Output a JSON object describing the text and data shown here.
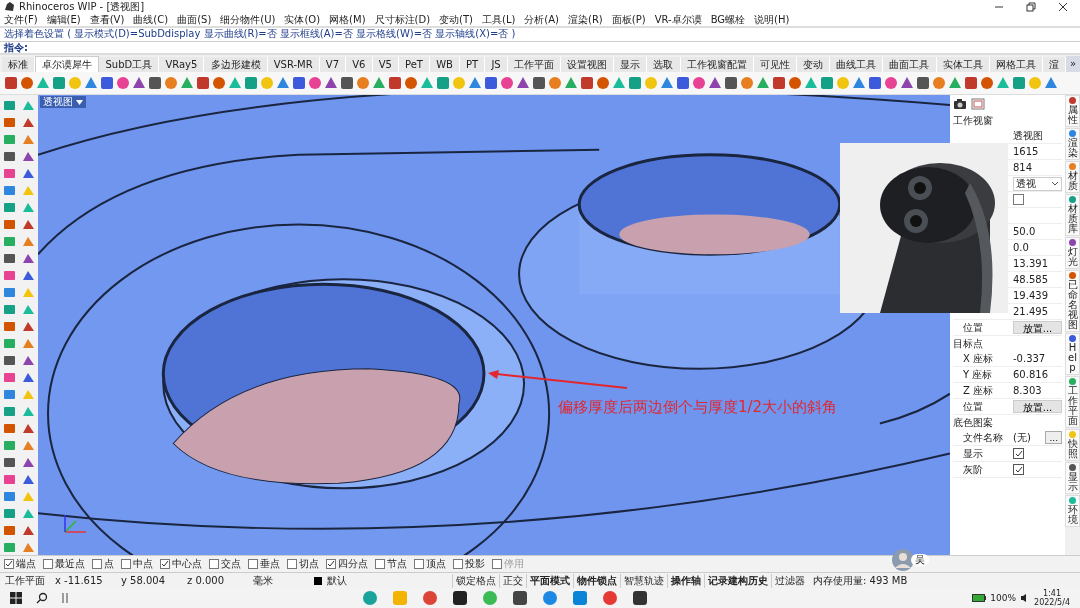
{
  "window": {
    "title": "Rhinoceros WIP - [透视图]"
  },
  "menu": [
    "文件(F)",
    "编辑(E)",
    "查看(V)",
    "曲线(C)",
    "曲面(S)",
    "细分物件(U)",
    "实体(O)",
    "网格(M)",
    "尺寸标注(D)",
    "变动(T)",
    "工具(L)",
    "分析(A)",
    "渲染(R)",
    "面板(P)",
    "VR-卓尔谟",
    "BG螺栓",
    "说明(H)"
  ],
  "command": {
    "history": "选择着色设置 ( 显示模式(D)=SubDdisplay  显示曲线(R)=否  显示框线(A)=否  显示格线(W)=否  显示轴线(X)=否 )",
    "prompt": "指令:"
  },
  "tabs": [
    {
      "label": "标准",
      "selected": false
    },
    {
      "label": "卓尔谟犀牛",
      "selected": true
    },
    {
      "label": "SubD工具",
      "selected": false
    },
    {
      "label": "VRay5",
      "selected": false
    },
    {
      "label": "多边形建模",
      "selected": false
    },
    {
      "label": "VSR-MR",
      "selected": false
    },
    {
      "label": "V7",
      "selected": false
    },
    {
      "label": "V6",
      "selected": false
    },
    {
      "label": "V5",
      "selected": false
    },
    {
      "label": "PeT",
      "selected": false
    },
    {
      "label": "WB",
      "selected": false
    },
    {
      "label": "PT",
      "selected": false
    },
    {
      "label": "JS",
      "selected": false
    },
    {
      "label": "工作平面",
      "selected": false
    },
    {
      "label": "设置视图",
      "selected": false
    },
    {
      "label": "显示",
      "selected": false
    },
    {
      "label": "选取",
      "selected": false
    },
    {
      "label": "工作视窗配置",
      "selected": false
    },
    {
      "label": "可见性",
      "selected": false
    },
    {
      "label": "变动",
      "selected": false
    },
    {
      "label": "曲线工具",
      "selected": false
    },
    {
      "label": "曲面工具",
      "selected": false
    },
    {
      "label": "实体工具",
      "selected": false
    },
    {
      "label": "网格工具",
      "selected": false
    },
    {
      "label": "渲",
      "selected": false
    }
  ],
  "tabs_more": "»",
  "viewport": {
    "tab": "透视图",
    "annotation": "偏移厚度后两边倒个与厚度1/2大小的斜角",
    "presenter": "吴"
  },
  "panel": {
    "title": "工作视窗",
    "viewport_rows": [
      {
        "kind": "text",
        "value": "透视图"
      },
      {
        "kind": "text",
        "value": "1615"
      },
      {
        "kind": "text",
        "value": "814"
      },
      {
        "kind": "dropdown",
        "value": "透视"
      },
      {
        "kind": "checkbox",
        "checked": false
      },
      {
        "kind": "empty"
      },
      {
        "kind": "text",
        "value": "50.0"
      },
      {
        "kind": "text",
        "value": "0.0"
      },
      {
        "kind": "text",
        "value": "13.391"
      },
      {
        "kind": "text",
        "value": "48.585"
      },
      {
        "kind": "text",
        "value": "19.439"
      },
      {
        "kind": "text",
        "value": "21.495"
      },
      {
        "kind": "button",
        "label": "位置",
        "value": "放置..."
      }
    ],
    "target_title": "目标点",
    "target_rows": [
      {
        "kind": "text",
        "label": "X 座标",
        "value": "-0.337"
      },
      {
        "kind": "text",
        "label": "Y 座标",
        "value": "60.816"
      },
      {
        "kind": "text",
        "label": "Z 座标",
        "value": "8.303"
      },
      {
        "kind": "button",
        "label": "位置",
        "value": "放置..."
      }
    ],
    "background_title": "底色图案",
    "background_rows": [
      {
        "kind": "browse",
        "label": "文件名称",
        "value": "(无)",
        "button": "..."
      },
      {
        "kind": "checkbox",
        "label": "显示",
        "checked": true
      },
      {
        "kind": "checkbox",
        "label": "灰阶",
        "checked": true
      }
    ]
  },
  "side_tabs": [
    "属性",
    "渲染",
    "材质",
    "材质库",
    "灯光",
    "已命名视图",
    "Help",
    "工作平面",
    "快照",
    "显示",
    "环境"
  ],
  "osnaps": [
    {
      "label": "端点",
      "checked": true,
      "disabled": false
    },
    {
      "label": "最近点",
      "checked": false,
      "disabled": false
    },
    {
      "label": "点",
      "checked": false,
      "disabled": false
    },
    {
      "label": "中点",
      "checked": false,
      "disabled": false
    },
    {
      "label": "中心点",
      "checked": true,
      "disabled": false
    },
    {
      "label": "交点",
      "checked": false,
      "disabled": false
    },
    {
      "label": "垂点",
      "checked": false,
      "disabled": false
    },
    {
      "label": "切点",
      "checked": false,
      "disabled": false
    },
    {
      "label": "四分点",
      "checked": true,
      "disabled": false
    },
    {
      "label": "节点",
      "checked": false,
      "disabled": false
    },
    {
      "label": "顶点",
      "checked": false,
      "disabled": false
    },
    {
      "label": "投影",
      "checked": false,
      "disabled": false
    },
    {
      "label": "停用",
      "checked": false,
      "disabled": true
    }
  ],
  "status": {
    "plane": "工作平面",
    "x": "x -11.615",
    "y": "y 58.004",
    "z": "z 0.000",
    "units": "毫米",
    "layer": "默认",
    "panes": [
      {
        "label": "锁定格点",
        "on": false
      },
      {
        "label": "正交",
        "on": false
      },
      {
        "label": "平面模式",
        "on": true
      },
      {
        "label": "物件锁点",
        "on": true
      },
      {
        "label": "智慧轨迹",
        "on": false
      },
      {
        "label": "操作轴",
        "on": true
      },
      {
        "label": "记录建构历史",
        "on": true
      },
      {
        "label": "过滤器",
        "on": false
      }
    ],
    "memory": "内存使用量: 493 MB"
  },
  "taskbar": {
    "battery": "100%",
    "time": "1:41",
    "date": "2022/5/4"
  }
}
